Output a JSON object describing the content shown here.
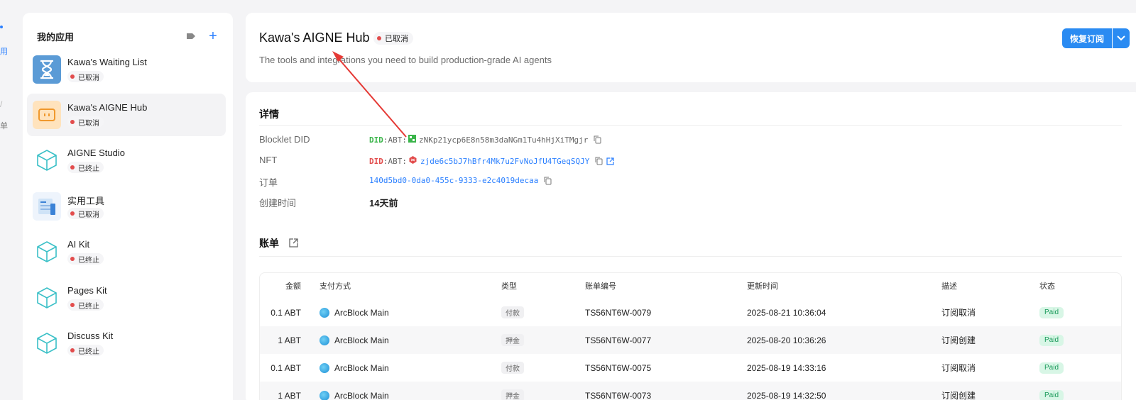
{
  "left_nav": {
    "frag1": "用",
    "frag2": "/",
    "frag3": "单"
  },
  "sidebar": {
    "title": "我的应用",
    "items": [
      {
        "name": "Kawa's Waiting List",
        "status": "已取消",
        "icon": "hourglass-icon"
      },
      {
        "name": "Kawa's AIGNE Hub",
        "status": "已取消",
        "icon": "aigne-hub-icon"
      },
      {
        "name": "AIGNE Studio",
        "status": "已终止",
        "icon": "cube-icon"
      },
      {
        "name": "实用工具",
        "status": "已取消",
        "icon": "tools-icon"
      },
      {
        "name": "AI Kit",
        "status": "已终止",
        "icon": "cube-icon"
      },
      {
        "name": "Pages Kit",
        "status": "已终止",
        "icon": "cube-icon"
      },
      {
        "name": "Discuss Kit",
        "status": "已终止",
        "icon": "cube-icon"
      }
    ]
  },
  "header": {
    "title": "Kawa's AIGNE Hub",
    "status": "已取消",
    "description": "The tools and integrations you need to build production-grade AI agents",
    "resume_label": "恢复订阅"
  },
  "details": {
    "title": "详情",
    "blocklet_did_label": "Blocklet DID",
    "blocklet_did_prefix": "DID",
    "blocklet_did_type": ":ABT:",
    "blocklet_did_value": "zNKp21ycp6E8n58m3daNGm1Tu4hHjXiTMgjr",
    "nft_label": "NFT",
    "nft_prefix": "DID",
    "nft_type": ":ABT:",
    "nft_value": "zjde6c5bJ7hBfr4Mk7u2FvNoJfU4TGeqSQJY",
    "order_label": "订单",
    "order_value": "140d5bd0-0da0-455c-9333-e2c4019decaa",
    "created_label": "创建时间",
    "created_value": "14天前"
  },
  "billing": {
    "title": "账单",
    "columns": [
      "金额",
      "支付方式",
      "类型",
      "账单编号",
      "更新时间",
      "描述",
      "状态"
    ],
    "rows": [
      {
        "amount": "0.1 ABT",
        "method": "ArcBlock Main",
        "type": "付款",
        "number": "TS56NT6W-0079",
        "time": "2025-08-21 10:36:04",
        "desc": "订阅取消",
        "status": "Paid"
      },
      {
        "amount": "1 ABT",
        "method": "ArcBlock Main",
        "type": "押金",
        "number": "TS56NT6W-0077",
        "time": "2025-08-20 10:36:26",
        "desc": "订阅创建",
        "status": "Paid"
      },
      {
        "amount": "0.1 ABT",
        "method": "ArcBlock Main",
        "type": "付款",
        "number": "TS56NT6W-0075",
        "time": "2025-08-19 14:33:16",
        "desc": "订阅取消",
        "status": "Paid"
      },
      {
        "amount": "1 ABT",
        "method": "ArcBlock Main",
        "type": "押金",
        "number": "TS56NT6W-0073",
        "time": "2025-08-19 14:32:50",
        "desc": "订阅创建",
        "status": "Paid"
      }
    ]
  },
  "colors": {
    "accent": "#2a8bf2",
    "cancel_dot": "#e24c4c",
    "paid_bg": "#d8f6e6",
    "arrow": "#e53935"
  }
}
